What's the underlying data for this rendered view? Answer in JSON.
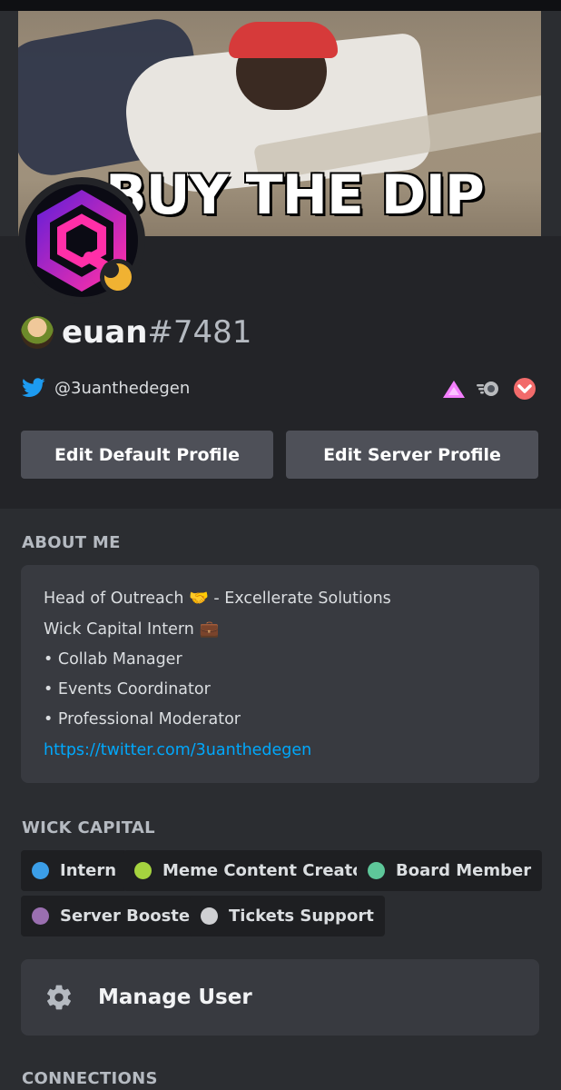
{
  "banner": {
    "caption": "BUY THE DIP"
  },
  "profile": {
    "username": "euan",
    "discriminator": "#7481",
    "status": "idle",
    "twitter_handle": "@3uanthedegen",
    "badges": [
      "hypesquad-icon",
      "nitro-icon",
      "server-boost-icon"
    ]
  },
  "buttons": {
    "edit_default": "Edit Default Profile",
    "edit_server": "Edit Server Profile"
  },
  "about": {
    "title": "ABOUT ME",
    "lines": [
      "Head of Outreach 🤝 - Excellerate Solutions",
      "Wick Capital Intern 💼",
      "• Collab Manager",
      "• Events Coordinator",
      "• Professional Moderator"
    ],
    "link": "https://twitter.com/3uanthedegen"
  },
  "roles": {
    "title": "WICK CAPITAL",
    "items": [
      {
        "label": "Intern",
        "color": "#3b9ee8"
      },
      {
        "label": "Meme Content Creator",
        "color": "#a5d33f"
      },
      {
        "label": "Board Member",
        "color": "#5ec79a"
      },
      {
        "label": "Server Booster",
        "color": "#9a6fb0"
      },
      {
        "label": "Tickets Support",
        "color": "#cfd0d3"
      }
    ]
  },
  "manage": {
    "label": "Manage User",
    "icon": "gear-icon"
  },
  "connections": {
    "title": "CONNECTIONS"
  }
}
